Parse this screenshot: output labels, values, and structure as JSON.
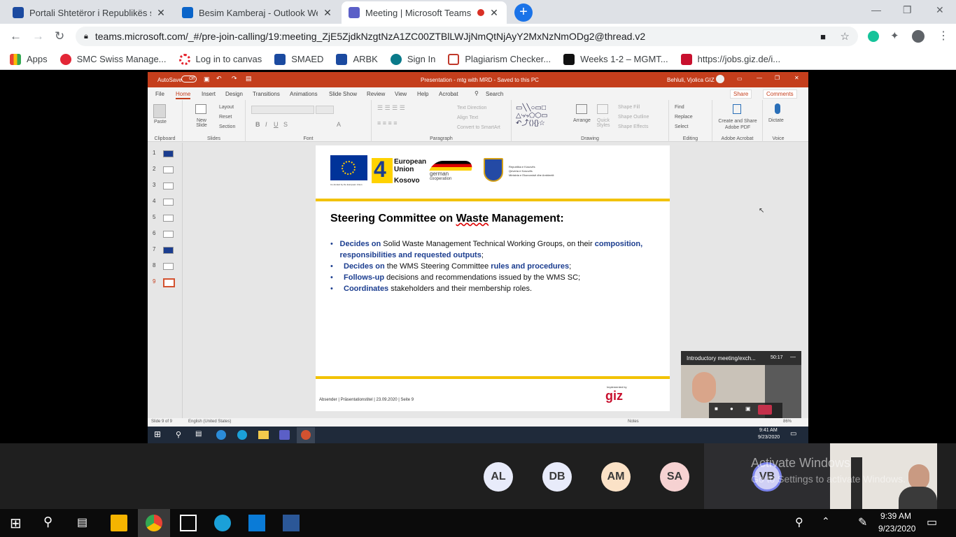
{
  "browser": {
    "tabs": [
      {
        "label": "Portali Shtetëror i Republikës së Kosovës"
      },
      {
        "label": "Besim Kamberaj - Outlook Web App"
      },
      {
        "label": "Meeting | Microsoft Teams"
      }
    ],
    "url": "teams.microsoft.com/_#/pre-join-calling/19:meeting_ZjE5ZjdkNzgtNzA1ZC00ZTBlLWJjNmQtNjAyY2MxNzNmODg2@thread.v2",
    "bookmarks": [
      {
        "label": "Apps"
      },
      {
        "label": "SMC Swiss Manage..."
      },
      {
        "label": "Log in to canvas"
      },
      {
        "label": "SMAED"
      },
      {
        "label": "ARBK"
      },
      {
        "label": "Sign In"
      },
      {
        "label": "Plagiarism Checker..."
      },
      {
        "label": "Weeks 1-2 – MGMT..."
      },
      {
        "label": "https://jobs.giz.de/i..."
      }
    ]
  },
  "ppt": {
    "autosave": "AutoSave",
    "autosave_state": "Off",
    "title": "Presentation - mtg with MRD  -  Saved to this PC",
    "user": "Behluli, Vjolica GIZ",
    "share": "Share",
    "comments": "Comments",
    "menu": [
      "File",
      "Home",
      "Insert",
      "Design",
      "Transitions",
      "Animations",
      "Slide Show",
      "Review",
      "View",
      "Help",
      "Acrobat"
    ],
    "search": "Search",
    "ribbon_groups": {
      "clipboard": "Clipboard",
      "slides": "Slides",
      "font": "Font",
      "paragraph": "Paragraph",
      "drawing": "Drawing",
      "editing": "Editing",
      "adobe": "Adobe Acrobat",
      "voice": "Voice"
    },
    "ribbon_items": {
      "paste": "Paste",
      "new_slide": "New Slide",
      "layout": "Layout",
      "reset": "Reset",
      "section": "Section",
      "text_direction": "Text Direction",
      "align_text": "Align Text",
      "convert_smartart": "Convert to SmartArt",
      "arrange": "Arrange",
      "quick_styles": "Quick Styles",
      "shape_fill": "Shape Fill",
      "shape_outline": "Shape Outline",
      "shape_effects": "Shape Effects",
      "find": "Find",
      "replace": "Replace",
      "select": "Select",
      "create_share": "Create and Share Adobe PDF",
      "dictate": "Dictate"
    },
    "slide_numbers": [
      "1",
      "2",
      "3",
      "4",
      "5",
      "6",
      "7",
      "8",
      "9"
    ],
    "slide": {
      "logos": {
        "eu_caption": "Co-funded by the European Union",
        "eu4": "European Union",
        "kosovo": "Kosovo",
        "german": "german",
        "cooperation": "cooperation",
        "ks_line1": "Republika e Kosovës",
        "ks_line2": "Qeveria e Kosovës",
        "ks_line3": "Ministria e Ekonomisë dhe Ambientit"
      },
      "heading_pre": "Steering Committee on ",
      "heading_word": "Waste",
      "heading_post": " Management:",
      "bullets": [
        {
          "b1": "Decides on",
          "t1": " Solid Waste Management Technical Working Groups, on their ",
          "b2": "composition, responsibilities and requested outputs",
          "t2": ";"
        },
        {
          "b1": "Decides on",
          "t1": " the WMS Steering Committee ",
          "b2": "rules and procedures",
          "t2": ";"
        },
        {
          "b1": "Follows-up",
          "t1": " decisions and recommendations issued by the WMS SC;",
          "b2": "",
          "t2": ""
        },
        {
          "b1": "Coordinates",
          "t1": " stakeholders and their membership roles.",
          "b2": "",
          "t2": ""
        }
      ],
      "footer": "Absender  |  Präsentationstitel  | 23.09.2020  |  Seite 9",
      "implemented_by": "Implemented by",
      "giz": "giz"
    },
    "status_slide": "Slide 9 of 9",
    "status_lang": "English (United States)",
    "status_notes": "Notes",
    "zoom": "86%",
    "inner_time": "9:41 AM",
    "inner_date": "9/23/2020",
    "video_title": "Introductory meeting/exch...",
    "video_time": "50:17"
  },
  "participants": [
    {
      "initials": "AL",
      "color": "#e8ebfa"
    },
    {
      "initials": "DB",
      "color": "#e8ebfa"
    },
    {
      "initials": "AM",
      "color": "#fbe2c7"
    },
    {
      "initials": "SA",
      "color": "#f6d2d2"
    },
    {
      "initials": "VB",
      "color": "#d0d0f5"
    }
  ],
  "activate": {
    "title": "Activate Windows",
    "sub": "Go to Settings to activate Windows."
  },
  "taskbar": {
    "time": "9:39 AM",
    "date": "9/23/2020"
  }
}
